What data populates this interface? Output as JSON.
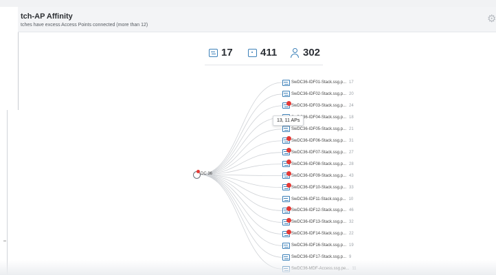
{
  "header": {
    "title": "tch-AP Affinity",
    "subtitle": "tches have excess Access Points connected (more than 12)"
  },
  "stats": {
    "switches": "17",
    "access_points": "411",
    "clients": "302"
  },
  "tree": {
    "root_label": "DC 36",
    "tooltip": "13, 11 APs",
    "leaves": [
      {
        "label": "SwDC36-IDF01-Stack.ssg.p...",
        "count": "17",
        "alert": false
      },
      {
        "label": "SwDC36-IDF02-Stack.ssg.p...",
        "count": "20",
        "alert": false
      },
      {
        "label": "SwDC36-IDF03-Stack.ssg.p...",
        "count": "24",
        "alert": true
      },
      {
        "label": "SwDC36-IDF04-Stack.ssg.p...",
        "count": "18",
        "alert": false
      },
      {
        "label": "SwDC36-IDF05-Stack.ssg.p...",
        "count": "21",
        "alert": false
      },
      {
        "label": "SwDC36-IDF06-Stack.ssg.p...",
        "count": "31",
        "alert": true
      },
      {
        "label": "SwDC36-IDF07-Stack.ssg.p...",
        "count": "27",
        "alert": true
      },
      {
        "label": "SwDC36-IDF08-Stack.ssg.p...",
        "count": "28",
        "alert": true
      },
      {
        "label": "SwDC36-IDF09-Stack.ssg.p...",
        "count": "43",
        "alert": true
      },
      {
        "label": "SwDC36-IDF10-Stack.ssg.p...",
        "count": "33",
        "alert": true
      },
      {
        "label": "SwDC36-IDF11-Stack.ssg.p...",
        "count": "10",
        "alert": false
      },
      {
        "label": "SwDC36-IDF12-Stack.ssg.p...",
        "count": "46",
        "alert": true
      },
      {
        "label": "SwDC36-IDF13-Stack.ssg.p...",
        "count": "32",
        "alert": true
      },
      {
        "label": "SwDC36-IDF14-Stack.ssg.p...",
        "count": "22",
        "alert": true
      },
      {
        "label": "SwDC36-IDF16-Stack.ssg.p...",
        "count": "19",
        "alert": false
      },
      {
        "label": "SwDC36-IDF17-Stack.ssg.p...",
        "count": "9",
        "alert": false
      },
      {
        "label": "SwDC36-MDF-Access.ssg.pe...",
        "count": "11",
        "alert": false
      }
    ]
  },
  "colors": {
    "accent": "#3a7fb8",
    "alert": "#e53935",
    "link": "#cfd2d6"
  }
}
